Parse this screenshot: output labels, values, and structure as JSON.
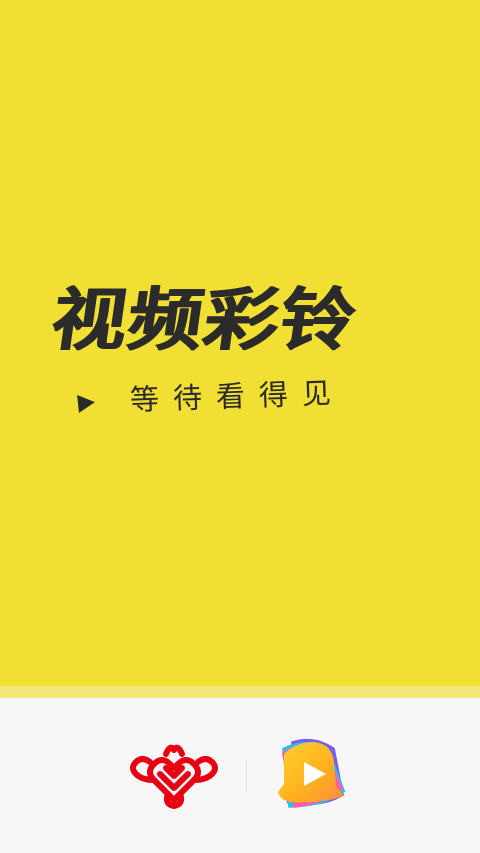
{
  "splash": {
    "headline": "视频彩铃",
    "tagline": "等待看得见"
  },
  "footer": {
    "partner_logo": "china-unicom-knot-logo",
    "app_logo": "video-ringtone-bell-play-logo"
  },
  "colors": {
    "splash_background": "#f2df33",
    "headline_text": "#2b2b2b",
    "footer_background": "#f7f7f7",
    "unicom_red": "#e60012"
  }
}
